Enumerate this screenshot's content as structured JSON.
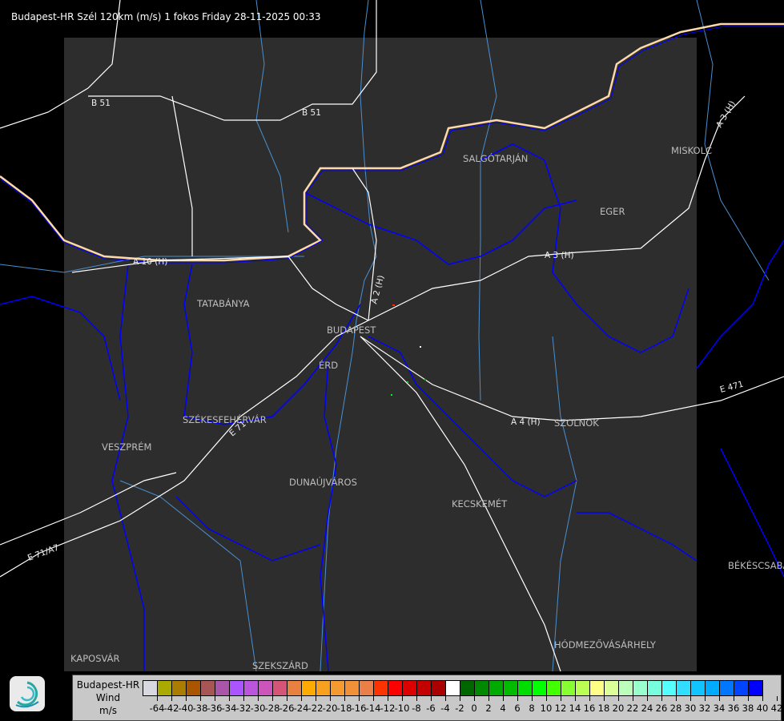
{
  "title": "Budapest-HR Szél 120km (m/s) 1 fokos Friday 28-11-2025 00:33",
  "map": {
    "cities": [
      "SALGÓTARJÁN",
      "MISKOLC",
      "EGER",
      "TATABÁNYA",
      "BUDAPEST",
      "ÉRD",
      "SZÉKESFEHÉRVÁR",
      "VESZPRÉM",
      "DUNAÚJVÁROS",
      "KECSKEMÉT",
      "SZOLNOK",
      "BÉKÉSCSABA",
      "HÓDMEZŐVÁSÁRHELY",
      "KAPOSVÁR",
      "SZEKSZÁRD"
    ],
    "roads": [
      "B 51",
      "B 51",
      "A 3 (H)",
      "A 3 (H)",
      "A 10 (H)",
      "A 2 (H)",
      "A 4 (H)",
      "E 71",
      "E 71/A7",
      "E 471"
    ],
    "colors": {
      "coverage": "#2d2d2d",
      "background": "#000000",
      "border": "#0000ff",
      "river": "#4a8fd0",
      "road": "#ffffff",
      "country_border": "#ffd9a8"
    }
  },
  "legend": {
    "title_lines": [
      "Budapest-HR",
      "Wind",
      "m/s"
    ],
    "tick_labels": [
      "-64",
      "-42",
      "-40",
      "-38",
      "-36",
      "-34",
      "-32",
      "-30",
      "-28",
      "-26",
      "-24",
      "-22",
      "-20",
      "-18",
      "-16",
      "-14",
      "-12",
      "-10",
      "-8",
      "-6",
      "-4",
      "-2",
      "0",
      "2",
      "4",
      "6",
      "8",
      "10",
      "12",
      "14",
      "16",
      "18",
      "20",
      "22",
      "24",
      "26",
      "28",
      "30",
      "32",
      "34",
      "36",
      "38",
      "40",
      "42"
    ],
    "colors": [
      "#d8d8e0",
      "#aaaa00",
      "#aa7d00",
      "#aa5500",
      "#aa5555",
      "#aa55aa",
      "#aa55ff",
      "#bb55dd",
      "#cc55bb",
      "#d45577",
      "#e88040",
      "#ffaa00",
      "#f8a020",
      "#f59a30",
      "#f09038",
      "#e88048",
      "#ff3300",
      "#ff0000",
      "#dd0000",
      "#c40000",
      "#aa0000",
      "#ffffff",
      "#006600",
      "#008800",
      "#00aa00",
      "#00bb00",
      "#00dd00",
      "#00ff00",
      "#44ff00",
      "#88ff33",
      "#bbff55",
      "#ffff88",
      "#ddff99",
      "#bbffbb",
      "#99ffcc",
      "#77ffdd",
      "#55ffff",
      "#33ddff",
      "#11c4ff",
      "#00aaff",
      "#0077ff",
      "#0044ff",
      "#0000ff"
    ]
  },
  "logo": {
    "name": "wind-swirl-logo"
  }
}
